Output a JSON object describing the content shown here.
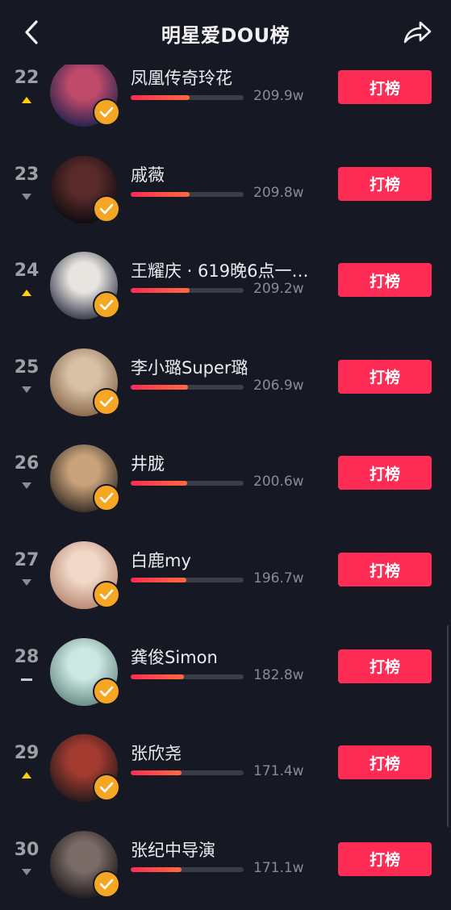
{
  "header": {
    "title": "明星爱DOU榜",
    "back_icon": "chevron-left-icon",
    "share_icon": "share-arrow-icon"
  },
  "colors": {
    "background": "#161823",
    "accent": "#fe2c55",
    "badge": "#f5a623",
    "trend_up": "#ffd200",
    "trend_down": "#8a8b93"
  },
  "vote_label": "打榜",
  "rows": [
    {
      "rank": "22",
      "trend": "up",
      "name": "凤凰传奇玲花",
      "score": "209.9w",
      "progress": 0.52,
      "avatar": [
        "#c04a6a",
        "#2b2450"
      ]
    },
    {
      "rank": "23",
      "trend": "down",
      "name": "戚薇",
      "score": "209.8w",
      "progress": 0.52,
      "avatar": [
        "#5a2a2a",
        "#0e0d10"
      ]
    },
    {
      "rank": "24",
      "trend": "up",
      "name": "王耀庆 · 619晚6点一…",
      "score": "209.2w",
      "progress": 0.52,
      "avatar": [
        "#e8e4e0",
        "#3a3f50"
      ]
    },
    {
      "rank": "25",
      "trend": "down",
      "name": "李小璐Super璐",
      "score": "206.9w",
      "progress": 0.51,
      "avatar": [
        "#d8c2a6",
        "#8c6a4e"
      ]
    },
    {
      "rank": "26",
      "trend": "down",
      "name": "井胧",
      "score": "200.6w",
      "progress": 0.5,
      "avatar": [
        "#c7a27a",
        "#3c3028"
      ]
    },
    {
      "rank": "27",
      "trend": "down",
      "name": "白鹿my",
      "score": "196.7w",
      "progress": 0.49,
      "avatar": [
        "#f1d8c8",
        "#b98b74"
      ]
    },
    {
      "rank": "28",
      "trend": "same",
      "name": "龚俊Simon",
      "score": "182.8w",
      "progress": 0.47,
      "avatar": [
        "#cde8e2",
        "#6b8f8a"
      ]
    },
    {
      "rank": "29",
      "trend": "up",
      "name": "张欣尧",
      "score": "171.4w",
      "progress": 0.45,
      "avatar": [
        "#a33b30",
        "#2a1b1a"
      ]
    },
    {
      "rank": "30",
      "trend": "down",
      "name": "张纪中导演",
      "score": "171.1w",
      "progress": 0.45,
      "avatar": [
        "#7a6b66",
        "#1f1b1c"
      ]
    }
  ]
}
